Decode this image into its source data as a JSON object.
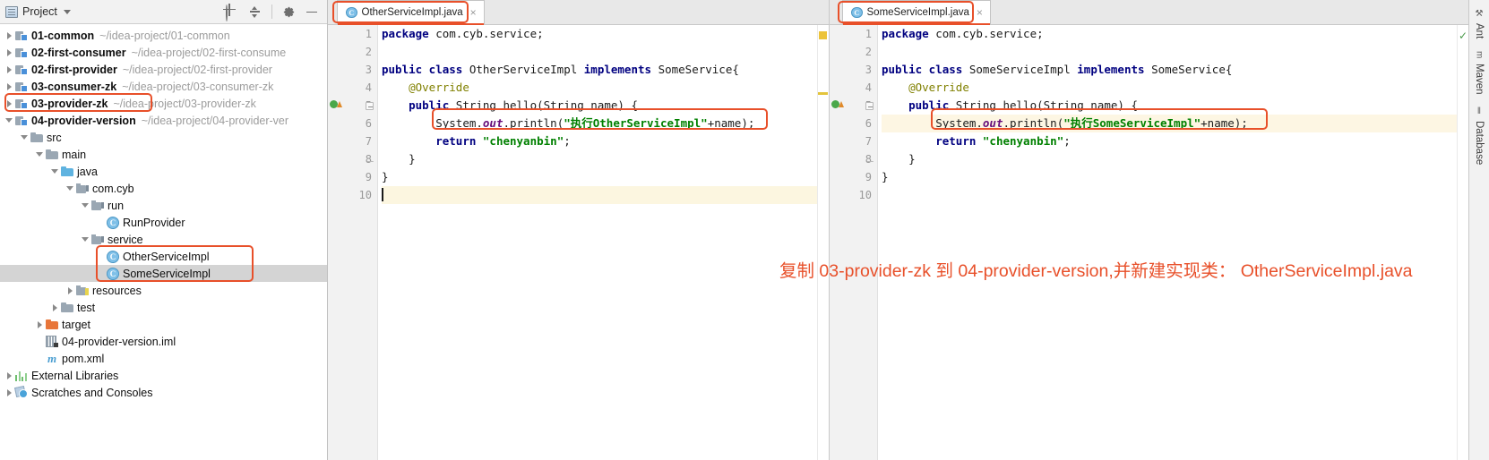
{
  "project_panel": {
    "title": "Project",
    "icons": [
      {
        "name": "locate-icon"
      },
      {
        "name": "collapse-all-icon"
      },
      {
        "name": "settings-gear-icon"
      },
      {
        "name": "minimize-icon"
      }
    ],
    "tree": [
      {
        "label": "01-common",
        "path": "~/idea-project/01-common",
        "icon": "module-icon",
        "arrow": "closed",
        "indent": 0,
        "bold": true
      },
      {
        "label": "02-first-consumer",
        "path": "~/idea-project/02-first-consume",
        "icon": "module-icon",
        "arrow": "closed",
        "indent": 0,
        "bold": true
      },
      {
        "label": "02-first-provider",
        "path": "~/idea-project/02-first-provider",
        "icon": "module-icon",
        "arrow": "closed",
        "indent": 0,
        "bold": true
      },
      {
        "label": "03-consumer-zk",
        "path": "~/idea-project/03-consumer-zk",
        "icon": "module-icon",
        "arrow": "closed",
        "indent": 0,
        "bold": true
      },
      {
        "label": "03-provider-zk",
        "path": "~/idea-project/03-provider-zk",
        "icon": "module-icon",
        "arrow": "closed",
        "indent": 0,
        "bold": true
      },
      {
        "label": "04-provider-version",
        "path": "~/idea-project/04-provider-ver",
        "icon": "module-icon",
        "arrow": "open",
        "indent": 0,
        "bold": true
      },
      {
        "label": "src",
        "path": "",
        "icon": "folder-icon",
        "arrow": "open",
        "indent": 1,
        "bold": false
      },
      {
        "label": "main",
        "path": "",
        "icon": "folder-icon",
        "arrow": "open",
        "indent": 2,
        "bold": false
      },
      {
        "label": "java",
        "path": "",
        "icon": "source-folder-icon",
        "arrow": "open",
        "indent": 3,
        "bold": false
      },
      {
        "label": "com.cyb",
        "path": "",
        "icon": "package-icon",
        "arrow": "open",
        "indent": 4,
        "bold": false
      },
      {
        "label": "run",
        "path": "",
        "icon": "package-icon",
        "arrow": "open",
        "indent": 5,
        "bold": false
      },
      {
        "label": "RunProvider",
        "path": "",
        "icon": "class-icon",
        "arrow": "none",
        "indent": 6,
        "bold": false
      },
      {
        "label": "service",
        "path": "",
        "icon": "package-icon",
        "arrow": "open",
        "indent": 5,
        "bold": false
      },
      {
        "label": "OtherServiceImpl",
        "path": "",
        "icon": "class-icon",
        "arrow": "none",
        "indent": 6,
        "bold": false
      },
      {
        "label": "SomeServiceImpl",
        "path": "",
        "icon": "class-icon",
        "arrow": "none",
        "indent": 6,
        "bold": false,
        "selected": true
      },
      {
        "label": "resources",
        "path": "",
        "icon": "resources-folder-icon",
        "arrow": "closed",
        "indent": 4,
        "bold": false
      },
      {
        "label": "test",
        "path": "",
        "icon": "folder-icon",
        "arrow": "closed",
        "indent": 3,
        "bold": false
      },
      {
        "label": "target",
        "path": "",
        "icon": "target-folder-icon",
        "arrow": "closed",
        "indent": 2,
        "bold": false
      },
      {
        "label": "04-provider-version.iml",
        "path": "",
        "icon": "iml-file-icon",
        "arrow": "none",
        "indent": 2,
        "bold": false
      },
      {
        "label": "pom.xml",
        "path": "",
        "icon": "maven-pom-icon",
        "arrow": "none",
        "indent": 2,
        "bold": false
      },
      {
        "label": "External Libraries",
        "path": "",
        "icon": "libraries-icon",
        "arrow": "closed",
        "indent": 0,
        "bold": false
      },
      {
        "label": "Scratches and Consoles",
        "path": "",
        "icon": "scratches-icon",
        "arrow": "closed",
        "indent": 0,
        "bold": false
      }
    ]
  },
  "editor_left": {
    "tab": {
      "label": "OtherServiceImpl.java",
      "icon": "class-icon",
      "close": "×"
    },
    "lines": [
      "1",
      "2",
      "3",
      "4",
      "5",
      "6",
      "7",
      "8",
      "9",
      "10"
    ],
    "highlight_line": 10,
    "code": [
      {
        "n": 1,
        "segs": [
          {
            "t": "package ",
            "c": "kw"
          },
          {
            "t": "com.cyb.service;",
            "c": ""
          }
        ],
        "indent": 0
      },
      {
        "n": 2,
        "segs": [],
        "indent": 0
      },
      {
        "n": 3,
        "segs": [
          {
            "t": "public class ",
            "c": "kw"
          },
          {
            "t": "OtherServiceImpl ",
            "c": "cls"
          },
          {
            "t": "implements ",
            "c": "kw"
          },
          {
            "t": "SomeService{",
            "c": "cls"
          }
        ],
        "indent": 0
      },
      {
        "n": 4,
        "segs": [
          {
            "t": "@Override",
            "c": "ann"
          }
        ],
        "indent": 1
      },
      {
        "n": 5,
        "segs": [
          {
            "t": "public ",
            "c": "kw"
          },
          {
            "t": "String hello(String name) {",
            "c": "cls"
          }
        ],
        "indent": 1
      },
      {
        "n": 6,
        "segs": [
          {
            "t": "System.",
            "c": ""
          },
          {
            "t": "out",
            "c": "fld"
          },
          {
            "t": ".println(",
            "c": ""
          },
          {
            "t": "\"执行OtherServiceImpl\"",
            "c": "str"
          },
          {
            "t": "+name);",
            "c": ""
          }
        ],
        "indent": 2
      },
      {
        "n": 7,
        "segs": [
          {
            "t": "return ",
            "c": "kw"
          },
          {
            "t": "\"chenyanbin\"",
            "c": "str"
          },
          {
            "t": ";",
            "c": ""
          }
        ],
        "indent": 2
      },
      {
        "n": 8,
        "segs": [
          {
            "t": "}",
            "c": ""
          }
        ],
        "indent": 1
      },
      {
        "n": 9,
        "segs": [
          {
            "t": "}",
            "c": ""
          }
        ],
        "indent": 0
      },
      {
        "n": 10,
        "segs": [],
        "indent": 0,
        "cursor": true
      }
    ]
  },
  "editor_right": {
    "tab": {
      "label": "SomeServiceImpl.java",
      "icon": "class-icon",
      "close": "×"
    },
    "lines": [
      "1",
      "2",
      "3",
      "4",
      "5",
      "6",
      "7",
      "8",
      "9",
      "10"
    ],
    "highlight_line": 6,
    "code": [
      {
        "n": 1,
        "segs": [
          {
            "t": "package ",
            "c": "kw"
          },
          {
            "t": "com.cyb.service;",
            "c": ""
          }
        ],
        "indent": 0
      },
      {
        "n": 2,
        "segs": [],
        "indent": 0
      },
      {
        "n": 3,
        "segs": [
          {
            "t": "public class ",
            "c": "kw"
          },
          {
            "t": "SomeServiceImpl ",
            "c": "cls"
          },
          {
            "t": "implements ",
            "c": "kw"
          },
          {
            "t": "SomeService{",
            "c": "cls"
          }
        ],
        "indent": 0
      },
      {
        "n": 4,
        "segs": [
          {
            "t": "@Override",
            "c": "ann"
          }
        ],
        "indent": 1
      },
      {
        "n": 5,
        "segs": [
          {
            "t": "public ",
            "c": "kw"
          },
          {
            "t": "String hello(String name) {",
            "c": "cls"
          }
        ],
        "indent": 1
      },
      {
        "n": 6,
        "segs": [
          {
            "t": "System.",
            "c": ""
          },
          {
            "t": "out",
            "c": "fld"
          },
          {
            "t": ".println(",
            "c": ""
          },
          {
            "t": "\"执行SomeServiceImpl\"",
            "c": "str"
          },
          {
            "t": "+name);",
            "c": ""
          }
        ],
        "indent": 2
      },
      {
        "n": 7,
        "segs": [
          {
            "t": "return ",
            "c": "kw"
          },
          {
            "t": "\"chenyanbin\"",
            "c": "str"
          },
          {
            "t": ";",
            "c": ""
          }
        ],
        "indent": 2
      },
      {
        "n": 8,
        "segs": [
          {
            "t": "}",
            "c": ""
          }
        ],
        "indent": 1
      },
      {
        "n": 9,
        "segs": [
          {
            "t": "}",
            "c": ""
          }
        ],
        "indent": 0
      },
      {
        "n": 10,
        "segs": [],
        "indent": 0
      }
    ]
  },
  "annotation": {
    "text": "复制 03-provider-zk 到 04-provider-version,并新建实现类： OtherServiceImpl.java",
    "color": "#e8502a"
  },
  "right_toolbar": {
    "tabs": [
      {
        "label": "Ant",
        "icon": "ant-icon"
      },
      {
        "label": "Maven",
        "icon": "maven-icon"
      },
      {
        "label": "Database",
        "icon": "database-icon"
      }
    ]
  },
  "colors": {
    "highlight_box": "#e8502a",
    "selection": "#d4d4d4",
    "caret_line": "#fcf6e0",
    "keyword": "#000080",
    "string": "#008000",
    "field": "#660e7a",
    "annotation": "#808000"
  }
}
